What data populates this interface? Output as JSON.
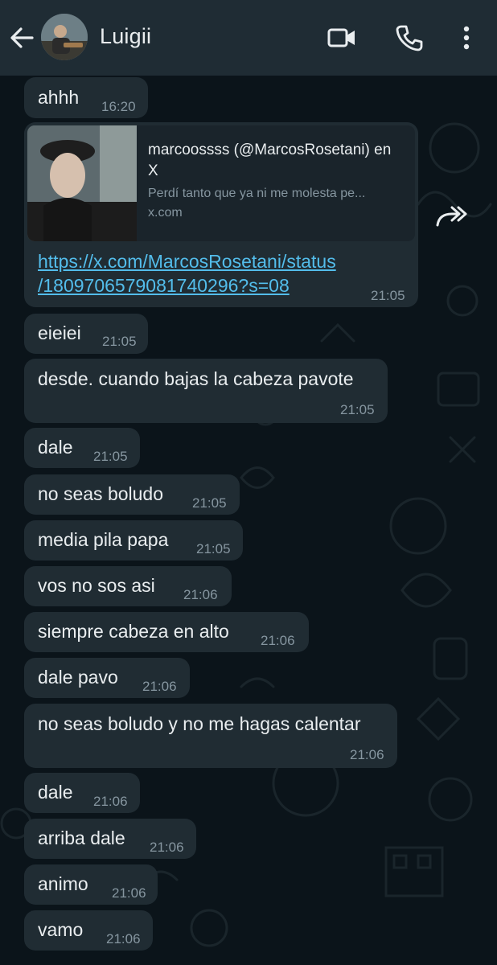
{
  "header": {
    "contact_name": "Luigii",
    "icons": [
      "back-arrow-icon",
      "video-call-icon",
      "phone-icon",
      "more-vertical-icon"
    ]
  },
  "link_preview": {
    "title": "marcoossss (@MarcosRosetani) en X",
    "description": "Perdí tanto que ya ni me molesta pe...",
    "domain": "x.com",
    "url": "https://x.com/MarcosRosetani/status/1809706579081740296?s=08",
    "url_line1": "https://x.com/MarcosRosetani/status",
    "url_line2": "/1809706579081740296?s=08",
    "time": "21:05"
  },
  "messages": [
    {
      "text": "ahhh",
      "time": "16:20"
    },
    {
      "text": "eieiei",
      "time": "21:05"
    },
    {
      "text": "desde. cuando bajas la cabeza pavote",
      "time": "21:05"
    },
    {
      "text": "dale",
      "time": "21:05"
    },
    {
      "text": "no seas boludo",
      "time": "21:05"
    },
    {
      "text": "media pila papa",
      "time": "21:05"
    },
    {
      "text": "vos no sos asi",
      "time": "21:06"
    },
    {
      "text": "siempre cabeza en alto",
      "time": "21:06"
    },
    {
      "text": "dale pavo",
      "time": "21:06"
    },
    {
      "text": "no seas boludo y no me hagas calentar",
      "time": "21:06"
    },
    {
      "text": "dale",
      "time": "21:06"
    },
    {
      "text": "arriba dale",
      "time": "21:06"
    },
    {
      "text": "animo",
      "time": "21:06"
    },
    {
      "text": "vamo",
      "time": "21:06"
    }
  ],
  "colors": {
    "header_bg": "#1f2c34",
    "chat_bg": "#0b141a",
    "bubble_bg": "#202c33",
    "link": "#53bdeb",
    "meta_text": "#8696a0"
  }
}
